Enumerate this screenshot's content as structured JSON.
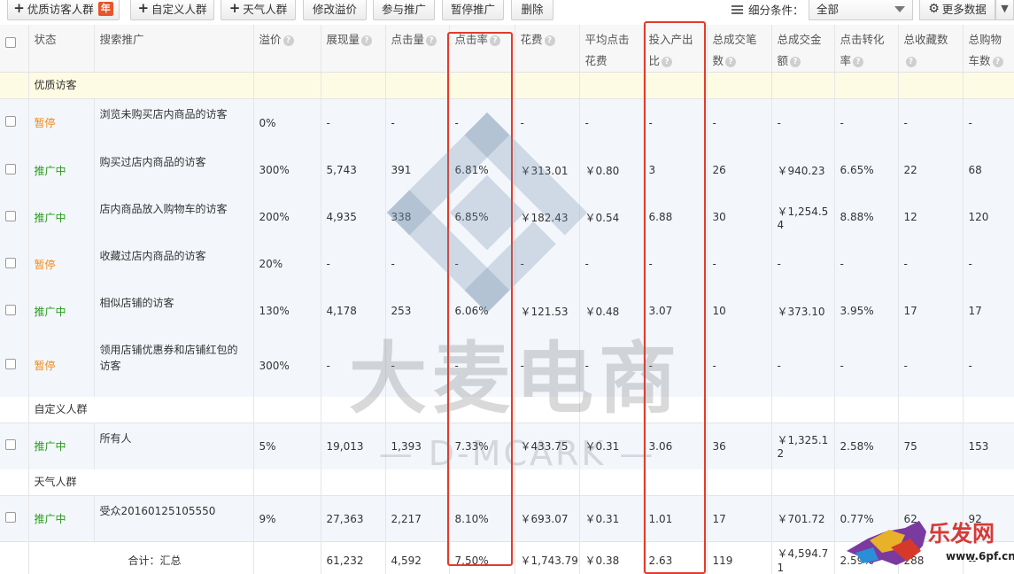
{
  "toolbar": {
    "buttons": [
      {
        "label": "优质访客人群",
        "badge": "年"
      },
      {
        "label": "自定义人群"
      },
      {
        "label": "天气人群"
      },
      {
        "label": "修改溢价"
      },
      {
        "label": "参与推广"
      },
      {
        "label": "暂停推广"
      },
      {
        "label": "删除"
      }
    ],
    "filter_label": "细分条件：",
    "filter_value": "全部",
    "more_label": "更多数据"
  },
  "columns": [
    "状态",
    "搜索推广",
    "溢价",
    "展现量",
    "点击量",
    "点击率",
    "花费",
    "平均点击花费",
    "投入产出比",
    "总成交笔数",
    "总成交金额",
    "点击转化率",
    "总收藏数",
    "总购物车数"
  ],
  "groups": [
    {
      "name": "优质访客",
      "rows": [
        {
          "status": "暂停",
          "status_type": "pause",
          "name": "浏览未购买店内商品的访客",
          "premium": "0%",
          "impressions": "-",
          "clicks": "-",
          "ctr": "-",
          "cost": "-",
          "cpc": "-",
          "roi": "-",
          "orders": "-",
          "gmv": "-",
          "cvr": "-",
          "favorites": "-",
          "carts": "-"
        },
        {
          "status": "推广中",
          "status_type": "run",
          "name": "购买过店内商品的访客",
          "premium": "300%",
          "impressions": "5,743",
          "clicks": "391",
          "ctr": "6.81%",
          "cost": "￥313.01",
          "cpc": "￥0.80",
          "roi": "3",
          "orders": "26",
          "gmv": "￥940.23",
          "cvr": "6.65%",
          "favorites": "22",
          "carts": "68"
        },
        {
          "status": "推广中",
          "status_type": "run",
          "name": "店内商品放入购物车的访客",
          "premium": "200%",
          "impressions": "4,935",
          "clicks": "338",
          "ctr": "6.85%",
          "cost": "￥182.43",
          "cpc": "￥0.54",
          "roi": "6.88",
          "orders": "30",
          "gmv": "￥1,254.54",
          "cvr": "8.88%",
          "favorites": "12",
          "carts": "120"
        },
        {
          "status": "暂停",
          "status_type": "pause",
          "name": "收藏过店内商品的访客",
          "premium": "20%",
          "impressions": "-",
          "clicks": "-",
          "ctr": "-",
          "cost": "-",
          "cpc": "-",
          "roi": "-",
          "orders": "-",
          "gmv": "-",
          "cvr": "-",
          "favorites": "-",
          "carts": "-"
        },
        {
          "status": "推广中",
          "status_type": "run",
          "name": "相似店铺的访客",
          "premium": "130%",
          "impressions": "4,178",
          "clicks": "253",
          "ctr": "6.06%",
          "cost": "￥121.53",
          "cpc": "￥0.48",
          "roi": "3.07",
          "orders": "10",
          "gmv": "￥373.10",
          "cvr": "3.95%",
          "favorites": "17",
          "carts": "17"
        },
        {
          "status": "暂停",
          "status_type": "pause",
          "name": "领用店铺优惠券和店铺红包的访客",
          "premium": "300%",
          "impressions": "-",
          "clicks": "-",
          "ctr": "-",
          "cost": "-",
          "cpc": "-",
          "roi": "-",
          "orders": "-",
          "gmv": "-",
          "cvr": "-",
          "favorites": "-",
          "carts": "-"
        }
      ]
    },
    {
      "name": "自定义人群",
      "rows": [
        {
          "status": "推广中",
          "status_type": "run",
          "name": "所有人",
          "premium": "5%",
          "impressions": "19,013",
          "clicks": "1,393",
          "ctr": "7.33%",
          "cost": "￥433.75",
          "cpc": "￥0.31",
          "roi": "3.06",
          "orders": "36",
          "gmv": "￥1,325.12",
          "cvr": "2.58%",
          "favorites": "75",
          "carts": "153"
        }
      ]
    },
    {
      "name": "天气人群",
      "rows": [
        {
          "status": "推广中",
          "status_type": "run",
          "name": "受众20160125105550",
          "premium": "9%",
          "impressions": "27,363",
          "clicks": "2,217",
          "ctr": "8.10%",
          "cost": "￥693.07",
          "cpc": "￥0.31",
          "roi": "1.01",
          "orders": "17",
          "gmv": "￥701.72",
          "cvr": "0.77%",
          "favorites": "62",
          "carts": "92"
        }
      ]
    }
  ],
  "total": {
    "label": "合计：汇总",
    "impressions": "61,232",
    "clicks": "4,592",
    "ctr": "7.50%",
    "cost": "￥1,743.79",
    "cpc": "￥0.38",
    "roi": "2.63",
    "orders": "119",
    "gmv": "￥4,594.71",
    "cvr": "2.59%",
    "favorites": "288",
    "carts": "--"
  },
  "watermark": {
    "main": "大麦电商",
    "sub": "— D-MCARK —"
  },
  "stamp": {
    "text": "乐发网",
    "url": "www.6pf.cn"
  },
  "colors": {
    "pause": "#f08a1a",
    "run": "#2a9b1a",
    "highlight": "#e23b2b",
    "group_bg": "#fdfbe3",
    "row_bg": "#f3f7fc"
  }
}
